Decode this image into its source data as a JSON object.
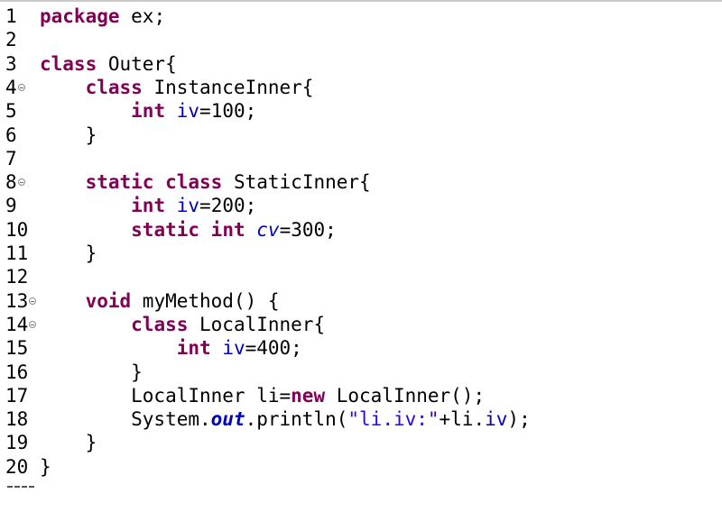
{
  "editor": {
    "colors": {
      "keyword": "#7f0055",
      "field": "#0000c0",
      "string": "#2a00ff",
      "text": "#000000"
    },
    "lines": [
      {
        "num": "1",
        "fold": false,
        "tokens": [
          {
            "t": "kw",
            "v": "package"
          },
          {
            "t": "p",
            "v": " ex;"
          }
        ]
      },
      {
        "num": "2",
        "fold": false,
        "tokens": []
      },
      {
        "num": "3",
        "fold": false,
        "tokens": [
          {
            "t": "kw",
            "v": "class"
          },
          {
            "t": "p",
            "v": " Outer{"
          }
        ]
      },
      {
        "num": "4",
        "fold": true,
        "tokens": [
          {
            "t": "p",
            "v": "    "
          },
          {
            "t": "kw",
            "v": "class"
          },
          {
            "t": "p",
            "v": " InstanceInner{"
          }
        ]
      },
      {
        "num": "5",
        "fold": false,
        "tokens": [
          {
            "t": "p",
            "v": "        "
          },
          {
            "t": "kw",
            "v": "int"
          },
          {
            "t": "p",
            "v": " "
          },
          {
            "t": "field",
            "v": "iv"
          },
          {
            "t": "p",
            "v": "=100;"
          }
        ]
      },
      {
        "num": "6",
        "fold": false,
        "tokens": [
          {
            "t": "p",
            "v": "    }"
          }
        ]
      },
      {
        "num": "7",
        "fold": false,
        "tokens": []
      },
      {
        "num": "8",
        "fold": true,
        "tokens": [
          {
            "t": "p",
            "v": "    "
          },
          {
            "t": "kw",
            "v": "static"
          },
          {
            "t": "p",
            "v": " "
          },
          {
            "t": "kw",
            "v": "class"
          },
          {
            "t": "p",
            "v": " StaticInner{"
          }
        ]
      },
      {
        "num": "9",
        "fold": false,
        "tokens": [
          {
            "t": "p",
            "v": "        "
          },
          {
            "t": "kw",
            "v": "int"
          },
          {
            "t": "p",
            "v": " "
          },
          {
            "t": "field",
            "v": "iv"
          },
          {
            "t": "p",
            "v": "=200;"
          }
        ]
      },
      {
        "num": "10",
        "fold": false,
        "tokens": [
          {
            "t": "p",
            "v": "        "
          },
          {
            "t": "kw",
            "v": "static"
          },
          {
            "t": "p",
            "v": " "
          },
          {
            "t": "kw",
            "v": "int"
          },
          {
            "t": "p",
            "v": " "
          },
          {
            "t": "static-field",
            "v": "cv"
          },
          {
            "t": "p",
            "v": "=300;"
          }
        ]
      },
      {
        "num": "11",
        "fold": false,
        "tokens": [
          {
            "t": "p",
            "v": "    }"
          }
        ]
      },
      {
        "num": "12",
        "fold": false,
        "tokens": []
      },
      {
        "num": "13",
        "fold": true,
        "tokens": [
          {
            "t": "p",
            "v": "    "
          },
          {
            "t": "kw",
            "v": "void"
          },
          {
            "t": "p",
            "v": " myMethod() {"
          }
        ]
      },
      {
        "num": "14",
        "fold": true,
        "tokens": [
          {
            "t": "p",
            "v": "        "
          },
          {
            "t": "kw",
            "v": "class"
          },
          {
            "t": "p",
            "v": " LocalInner{"
          }
        ]
      },
      {
        "num": "15",
        "fold": false,
        "tokens": [
          {
            "t": "p",
            "v": "            "
          },
          {
            "t": "kw",
            "v": "int"
          },
          {
            "t": "p",
            "v": " "
          },
          {
            "t": "field",
            "v": "iv"
          },
          {
            "t": "p",
            "v": "=400;"
          }
        ]
      },
      {
        "num": "16",
        "fold": false,
        "tokens": [
          {
            "t": "p",
            "v": "        }"
          }
        ]
      },
      {
        "num": "17",
        "fold": false,
        "tokens": [
          {
            "t": "p",
            "v": "        LocalInner li="
          },
          {
            "t": "kw",
            "v": "new"
          },
          {
            "t": "p",
            "v": " LocalInner();"
          }
        ]
      },
      {
        "num": "18",
        "fold": false,
        "tokens": [
          {
            "t": "p",
            "v": "        System."
          },
          {
            "t": "bold-static",
            "v": "out"
          },
          {
            "t": "p",
            "v": ".println("
          },
          {
            "t": "str",
            "v": "\"li.iv:\""
          },
          {
            "t": "p",
            "v": "+li."
          },
          {
            "t": "field",
            "v": "iv"
          },
          {
            "t": "p",
            "v": ");"
          }
        ]
      },
      {
        "num": "19",
        "fold": false,
        "tokens": [
          {
            "t": "p",
            "v": "    }"
          }
        ]
      },
      {
        "num": "20",
        "fold": false,
        "tokens": [
          {
            "t": "p",
            "v": "}"
          }
        ]
      }
    ]
  }
}
